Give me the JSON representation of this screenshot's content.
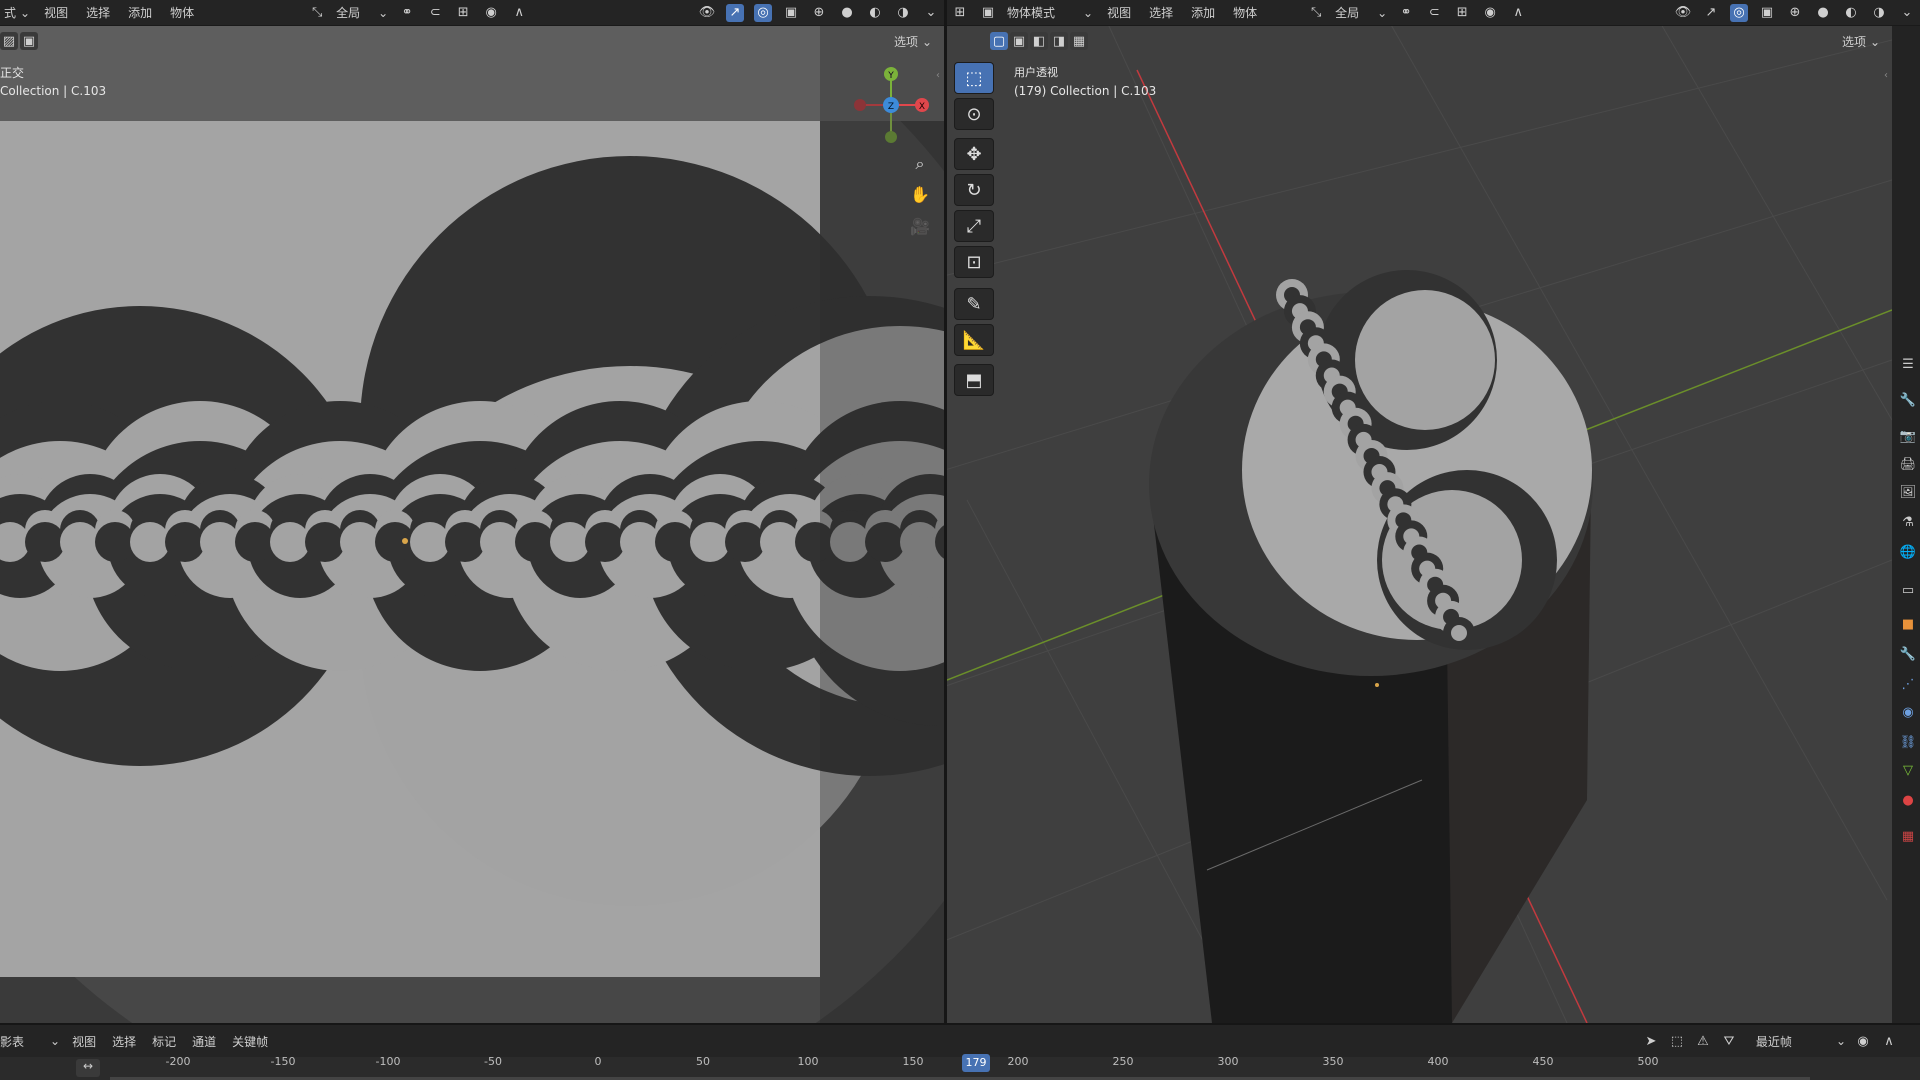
{
  "left_header": {
    "mode_label": "式",
    "menu": [
      "视图",
      "选择",
      "添加",
      "物体"
    ],
    "transform_space": "全局",
    "options_label": "选项"
  },
  "right_header": {
    "mode_label": "物体模式",
    "menu": [
      "视图",
      "选择",
      "添加",
      "物体"
    ],
    "transform_space": "全局",
    "options_label": "选项"
  },
  "left_viewport": {
    "view_name": "正交",
    "collection_label": "Collection | C.103"
  },
  "right_viewport": {
    "view_name": "用户透视",
    "collection_label": "(179) Collection | C.103"
  },
  "gizmo": {
    "x": "X",
    "y": "Y",
    "z": "Z"
  },
  "timeline": {
    "editor_label": "影表",
    "menu": [
      "视图",
      "选择",
      "标记",
      "通道",
      "关键帧"
    ],
    "snap_mode": "最近帧",
    "current_frame": "179",
    "ticks": [
      "-200",
      "-150",
      "-100",
      "-50",
      "0",
      "50",
      "100",
      "150",
      "200",
      "250",
      "300",
      "350",
      "400",
      "450",
      "500"
    ]
  },
  "icons": {
    "tools": [
      "select-box-icon",
      "cursor-icon",
      "move-icon",
      "rotate-icon",
      "scale-icon",
      "transform-icon",
      "annotate-icon",
      "measure-icon",
      "add-cube-icon"
    ],
    "properties": [
      "tool-icon",
      "render-icon",
      "output-icon",
      "view-layer-icon",
      "scene-icon",
      "world-icon",
      "collection-icon",
      "object-icon",
      "modifier-icon",
      "particles-icon",
      "physics-icon",
      "constraints-icon",
      "data-icon",
      "material-icon",
      "texture-icon"
    ]
  },
  "colors": {
    "accent": "#4772b3",
    "x_axis": "#e0474c",
    "y_axis": "#7bb23a",
    "z_axis": "#3d8bd9",
    "light_gray": "#a3a3a3",
    "dark_gray": "#323232"
  }
}
